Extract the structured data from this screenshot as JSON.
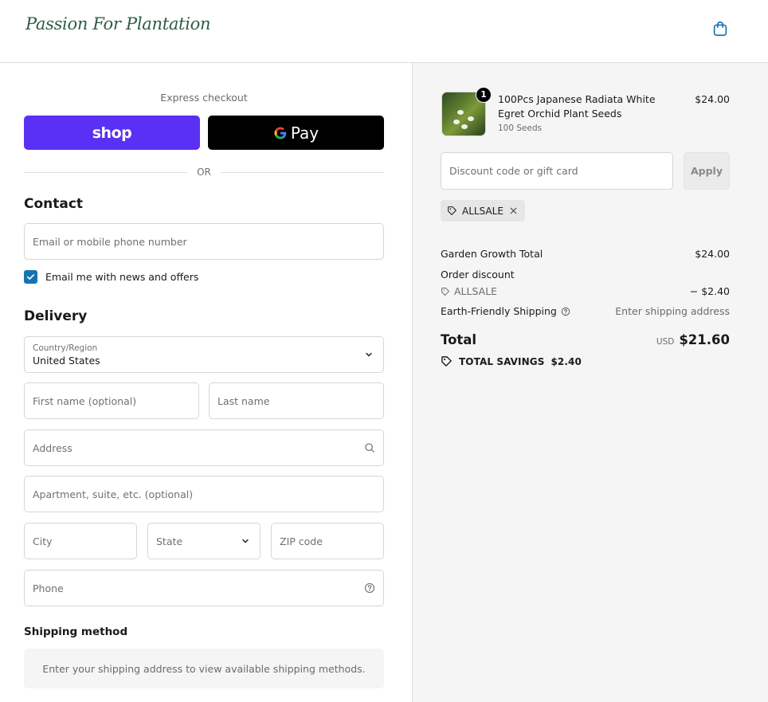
{
  "header": {
    "logo_text": "Passion For Plantation",
    "cart_icon": "shopping-bag-icon"
  },
  "express": {
    "label": "Express checkout",
    "shop_label": "shop",
    "gpay_label": "Pay",
    "or_label": "OR"
  },
  "contact": {
    "title": "Contact",
    "email_placeholder": "Email or mobile phone number",
    "newsletter_label": "Email me with news and offers",
    "newsletter_checked": true
  },
  "delivery": {
    "title": "Delivery",
    "country_label": "Country/Region",
    "country_value": "United States",
    "first_name_placeholder": "First name (optional)",
    "last_name_placeholder": "Last name",
    "address_placeholder": "Address",
    "apartment_placeholder": "Apartment, suite, etc. (optional)",
    "city_placeholder": "City",
    "state_placeholder": "State",
    "zip_placeholder": "ZIP code",
    "phone_placeholder": "Phone"
  },
  "shipping": {
    "title": "Shipping method",
    "message": "Enter your shipping address to view available shipping methods."
  },
  "summary": {
    "product": {
      "name": "100Pcs Japanese Radiata White Egret Orchid Plant Seeds",
      "variant": "100 Seeds",
      "price": "$24.00",
      "quantity": "1"
    },
    "discount_placeholder": "Discount code or gift card",
    "apply_label": "Apply",
    "applied_code": "ALLSALE",
    "subtotal_label": "Garden Growth Total",
    "subtotal_value": "$24.00",
    "order_discount_label": "Order discount",
    "discount_code": "ALLSALE",
    "discount_value": "− $2.40",
    "shipping_label": "Earth-Friendly Shipping",
    "shipping_value": "Enter shipping address",
    "total_label": "Total",
    "currency": "USD",
    "total_value": "$21.60",
    "savings_label": "TOTAL SAVINGS",
    "savings_value": "$2.40"
  },
  "colors": {
    "shop_purple": "#5a31f4",
    "checkbox_blue": "#1773b0",
    "logo_green": "#2f5c44"
  }
}
